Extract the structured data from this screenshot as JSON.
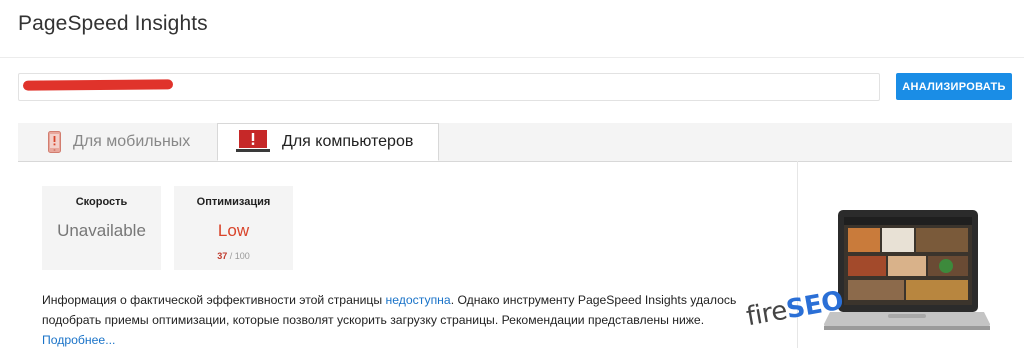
{
  "app": {
    "title": "PageSpeed Insights"
  },
  "url_bar": {
    "value": ""
  },
  "analyze_button": {
    "label": "АНАЛИЗИРОВАТЬ"
  },
  "tabs": [
    {
      "label": "Для мобильных",
      "active": false,
      "icon": "mobile-phone-icon"
    },
    {
      "label": "Для компьютеров",
      "active": true,
      "icon": "desktop-monitor-icon"
    }
  ],
  "metrics": {
    "speed": {
      "title": "Скорость",
      "value": "Unavailable"
    },
    "optimization": {
      "title": "Оптимизация",
      "value": "Low",
      "score": "37",
      "max": "/ 100"
    }
  },
  "info": {
    "text_before": "Информация о фактической эффективности этой страницы ",
    "link_unavailable": "недоступна",
    "text_after": ". Однако инструменту PageSpeed Insights удалось подобрать приемы оптимизации, которые позволят ускорить загрузку страницы. Рекомендации представлены ниже.",
    "more_link": "Подробнее..."
  },
  "watermark": {
    "prefix": "fire",
    "suffix": "SEO"
  },
  "colors": {
    "accent": "#1a8de6",
    "low": "#d9442a",
    "redaction": "#e0332b"
  }
}
